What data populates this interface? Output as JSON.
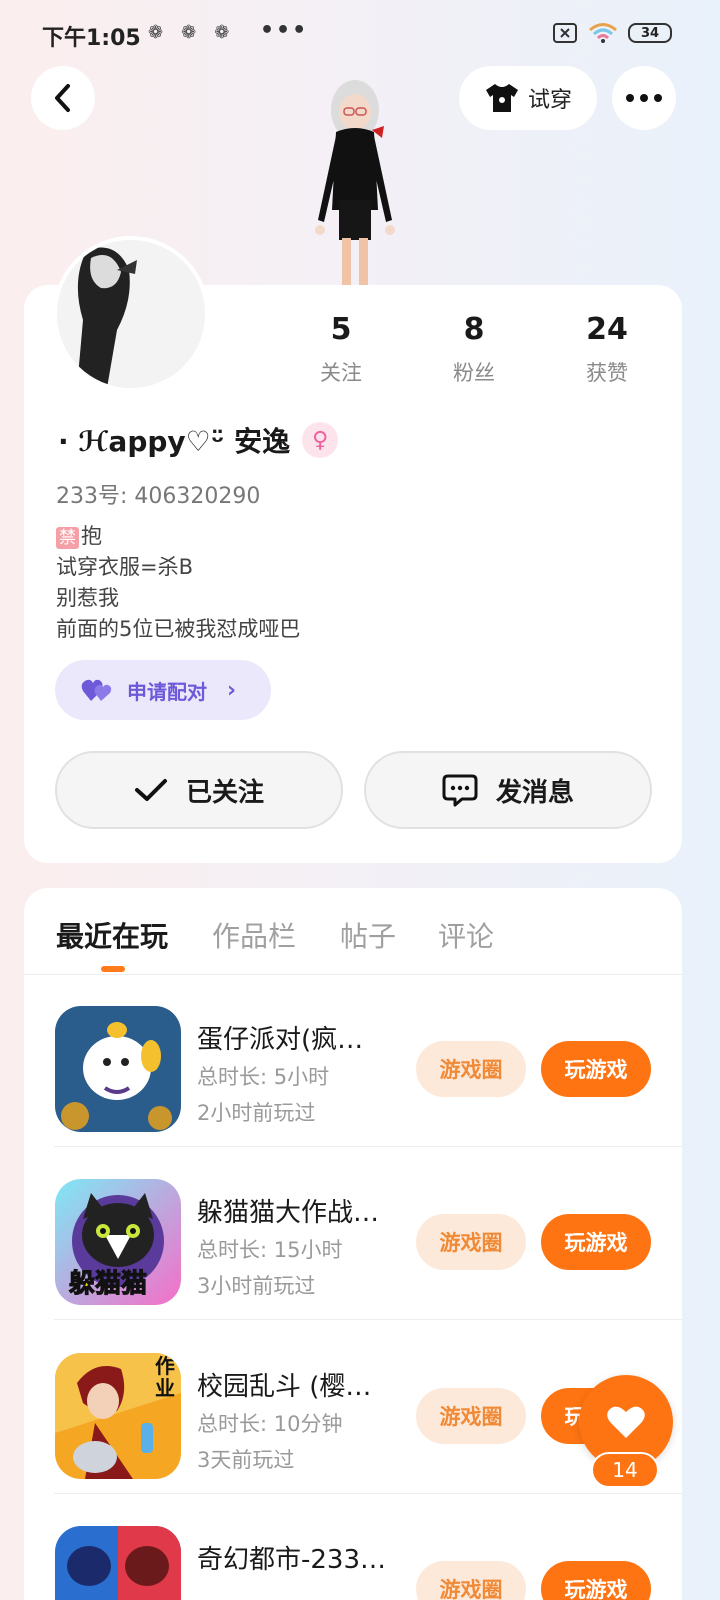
{
  "status_bar": {
    "time": "下午1:05",
    "more": "•••",
    "battery": "34"
  },
  "header": {
    "tryon_label": "试穿"
  },
  "profile": {
    "stats": [
      {
        "value": "5",
        "label": "关注"
      },
      {
        "value": "8",
        "label": "粉丝"
      },
      {
        "value": "24",
        "label": "获赞"
      }
    ],
    "username": "· ℋappy♡ᵕ̈ 安逸",
    "gender_symbol": "♀",
    "uid": "233号: 406320290",
    "bio_ban": "禁",
    "bio_lines": [
      "抱",
      "试穿衣服=杀B",
      "别惹我",
      "前面的5位已被我怼成哑巴"
    ],
    "pair_label": "申请配对",
    "follow_label": "已关注",
    "message_label": "发消息"
  },
  "tabs": [
    {
      "label": "最近在玩",
      "active": true
    },
    {
      "label": "作品栏",
      "active": false
    },
    {
      "label": "帖子",
      "active": false
    },
    {
      "label": "评论",
      "active": false
    }
  ],
  "games": [
    {
      "title": "蛋仔派对(疯…",
      "duration": "总时长: 5小时",
      "last_played": "2小时前玩过",
      "circle_label": "游戏圈",
      "play_label": "玩游戏"
    },
    {
      "title": "躲猫猫大作战…",
      "duration": "总时长: 15小时",
      "last_played": "3小时前玩过",
      "circle_label": "游戏圈",
      "play_label": "玩游戏",
      "icon_text": "躲猫猫"
    },
    {
      "title": "校园乱斗 (樱…",
      "duration": "总时长: 10分钟",
      "last_played": "3天前玩过",
      "circle_label": "游戏圈",
      "play_label": "玩游戏",
      "icon_text": "作业"
    },
    {
      "title": "奇幻都市-233…",
      "circle_label": "游戏圈",
      "play_label": "玩游戏"
    }
  ],
  "fab": {
    "count": "14"
  },
  "colors": {
    "accent": "#ff7412",
    "pair": "#6e5ad8",
    "circle_bg": "#fde9da"
  }
}
